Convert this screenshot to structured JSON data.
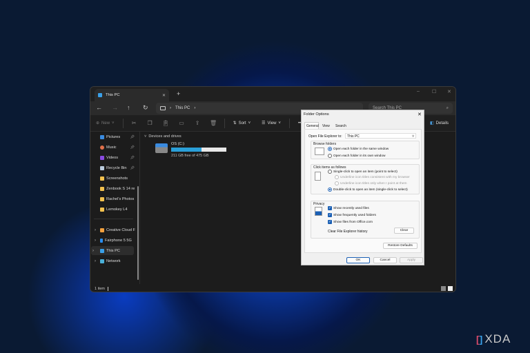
{
  "explorer": {
    "tab_title": "This PC",
    "new_tab": "+",
    "close_tab": "✕",
    "window_controls": {
      "minimize": "–",
      "maximize": "☐",
      "close": "✕"
    },
    "address": {
      "path": [
        "This PC"
      ],
      "search_placeholder": "Search This PC"
    },
    "toolbar": {
      "new_label": "New",
      "sort_label": "Sort",
      "view_label": "View",
      "more": "•••",
      "details_label": "Details"
    },
    "sidebar": {
      "quick": [
        {
          "label": "Pictures",
          "icon": "pictures-icon",
          "pinned": true
        },
        {
          "label": "Music",
          "icon": "music-icon",
          "pinned": true
        },
        {
          "label": "Videos",
          "icon": "videos-icon",
          "pinned": true
        },
        {
          "label": "Recycle Bin",
          "icon": "recycle-bin-icon",
          "pinned": true
        },
        {
          "label": "Screenshots",
          "icon": "folder-icon"
        },
        {
          "label": "Zenbook S 14 re",
          "icon": "folder-icon"
        },
        {
          "label": "Rachel's Photos",
          "icon": "folder-icon"
        },
        {
          "label": "Lemokey L4",
          "icon": "folder-icon"
        }
      ],
      "tree": [
        {
          "label": "Creative Cloud F",
          "icon": "creative-cloud-icon"
        },
        {
          "label": "Fairphone 5 5G",
          "icon": "phone-icon"
        },
        {
          "label": "This PC",
          "icon": "pc-icon",
          "selected": true
        },
        {
          "label": "Network",
          "icon": "network-icon"
        }
      ]
    },
    "content": {
      "group_label": "Devices and drives",
      "drive": {
        "name": "OS (C:)",
        "free_text": "211 GB free of 475 GB",
        "used_fraction": 0.556
      }
    },
    "status": {
      "count": "1 item"
    }
  },
  "dialog": {
    "title": "Folder Options",
    "close": "✕",
    "tabs": [
      "General",
      "View",
      "Search"
    ],
    "active_tab": "General",
    "open_to_label": "Open File Explorer to:",
    "open_to_value": "This PC",
    "browse": {
      "label": "Browse folders",
      "options": [
        "Open each folder in the same window",
        "Open each folder in its own window"
      ],
      "selected": 0
    },
    "click": {
      "label": "Click items as follows",
      "single": "Single-click to open an item (point to select)",
      "sub1": "Underline icon titles consistent with my browser",
      "sub2": "Underline icon titles only when I point at them",
      "double": "Double-click to open an item (single-click to select)"
    },
    "privacy": {
      "label": "Privacy",
      "checks": [
        "Show recently used files",
        "Show frequently used folders",
        "Show files from Office.com"
      ],
      "clear_label": "Clear File Explorer history",
      "clear_button": "Clear"
    },
    "restore": "Restore Defaults",
    "ok": "OK",
    "cancel": "Cancel",
    "apply": "Apply"
  },
  "watermark": "XDA",
  "colors": {
    "accent": "#1a5fb4",
    "drive_bar": "#2a9fd8"
  }
}
